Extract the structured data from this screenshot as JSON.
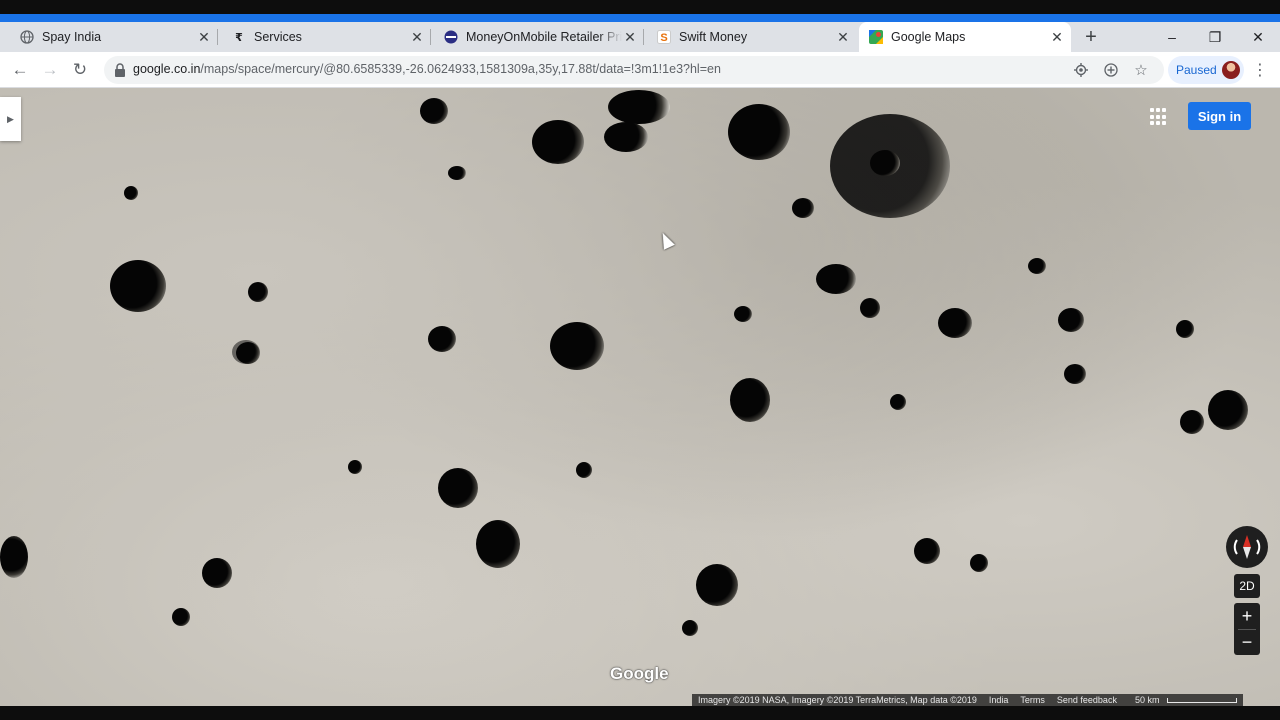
{
  "browser": {
    "tabs": [
      {
        "label": "Spay India",
        "icon": "globe-icon",
        "active": false
      },
      {
        "label": "Services",
        "icon": "rupee-icon",
        "active": false
      },
      {
        "label": "MoneyOnMobile Retailer Prim",
        "icon": "moneyonmobile-icon",
        "active": false
      },
      {
        "label": "Swift Money",
        "icon": "swift-money-icon",
        "active": false
      },
      {
        "label": "Google Maps",
        "icon": "google-maps-icon",
        "active": true
      }
    ],
    "new_tab_label": "+",
    "url_host": "google.co.in",
    "url_path": "/maps/space/mercury/@80.6585339,-26.0624933,1581309a,35y,17.88t/data=!3m1!1e3?hl=en",
    "profile_status": "Paused",
    "window_controls": {
      "minimize": "–",
      "maximize": "❐",
      "close": "✕"
    }
  },
  "maps": {
    "sign_in_label": "Sign in",
    "view_mode_label": "2D",
    "zoom_in_label": "+",
    "zoom_out_label": "−",
    "watermark": "Google",
    "attribution": {
      "imagery": "Imagery ©2019 NASA, Imagery ©2019 TerraMetrics, Map data ©2019",
      "region": "India",
      "terms": "Terms",
      "feedback": "Send feedback",
      "scale": "50 km"
    }
  },
  "colors": {
    "accent_blue": "#1a73e8",
    "surface": "#bbb7ae",
    "control_dark": "#1f1f1f",
    "compass_red": "#d93025"
  }
}
